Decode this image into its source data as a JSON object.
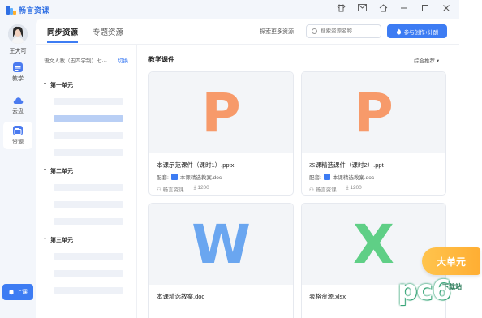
{
  "app": {
    "logo_text": "畅言资课",
    "window_icons": [
      "shirt-icon",
      "mail-icon",
      "home-icon",
      "minimize-icon",
      "maximize-icon",
      "close-icon"
    ]
  },
  "user": {
    "name": "王大可"
  },
  "nav": {
    "items": [
      {
        "label": "教学",
        "icon": "teach-icon"
      },
      {
        "label": "云盘",
        "icon": "cloud-icon"
      },
      {
        "label": "资源",
        "icon": "resource-icon",
        "active": true
      }
    ],
    "live_button": "上课"
  },
  "header": {
    "tabs": [
      {
        "label": "同步资源",
        "active": true
      },
      {
        "label": "专题资源",
        "active": false
      }
    ],
    "more_link": "探索更多资源",
    "search_placeholder": "搜索资源名称",
    "create_button": "参与创作+计酬"
  },
  "sidebar": {
    "textbook": "语文人教（五四学制）七···",
    "switch_label": "切换",
    "units": [
      "第一单元",
      "第二单元",
      "第三单元"
    ]
  },
  "content": {
    "title": "教学课件",
    "sort_label": "综合推荐",
    "cards": [
      {
        "thumb_letter": "P",
        "thumb_color": "#f79a6a",
        "name": "本课示范课件（课时1）.pptx",
        "meta_prefix": "配套:",
        "meta_doc": "本课精选教案.doc",
        "author": "畅言资课",
        "downloads": "1200"
      },
      {
        "thumb_letter": "P",
        "thumb_color": "#f79a6a",
        "name": "本课精选课件（课时2）.ppt",
        "meta_prefix": "配套:",
        "meta_doc": "本课精选教案.doc",
        "author": "畅言资课",
        "downloads": "1200"
      },
      {
        "thumb_letter": "W",
        "thumb_color": "#6aa6f0",
        "name": "本课精选教案.doc"
      },
      {
        "thumb_letter": "X",
        "thumb_color": "#5fcf86",
        "name": "表格资源.xlsx"
      }
    ]
  },
  "badge": {
    "label": "大单元"
  },
  "watermark": {
    "main": "pc6",
    "sub": "下载站"
  }
}
